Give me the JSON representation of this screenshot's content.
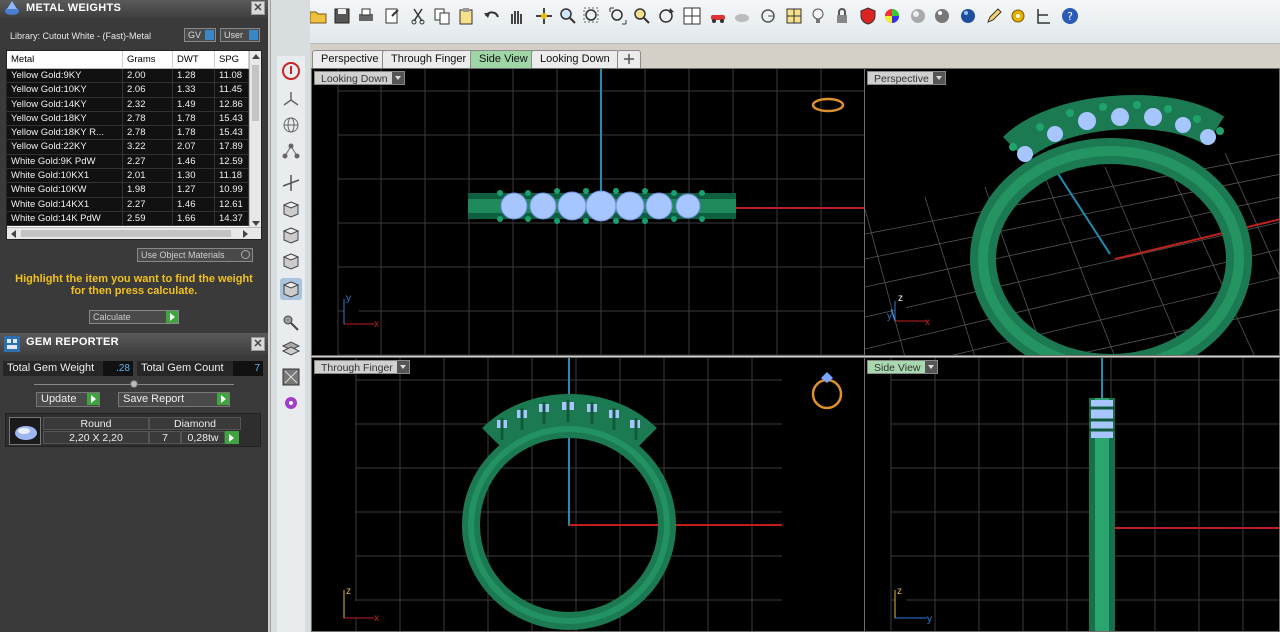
{
  "metal_weights": {
    "title": "METAL WEIGHTS",
    "library": "Library: Cutout White - (Fast)-Metal",
    "gv_label": "GV",
    "user_label": "User",
    "columns": [
      "Metal",
      "Grams",
      "DWT",
      "SPG"
    ],
    "rows": [
      [
        "Yellow Gold:9KY",
        "2.00",
        "1.28",
        "11.08"
      ],
      [
        "Yellow Gold:10KY",
        "2.06",
        "1.33",
        "11.45"
      ],
      [
        "Yellow Gold:14KY",
        "2.32",
        "1.49",
        "12.86"
      ],
      [
        "Yellow Gold:18KY",
        "2.78",
        "1.78",
        "15.43"
      ],
      [
        "Yellow Gold:18KY R...",
        "2.78",
        "1.78",
        "15.43"
      ],
      [
        "Yellow Gold:22KY",
        "3.22",
        "2.07",
        "17.89"
      ],
      [
        "White Gold:9K PdW",
        "2.27",
        "1.46",
        "12.59"
      ],
      [
        "White Gold:10KX1",
        "2.01",
        "1.30",
        "11.18"
      ],
      [
        "White Gold:10KW",
        "1.98",
        "1.27",
        "10.99"
      ],
      [
        "White Gold:14KX1",
        "2.27",
        "1.46",
        "12.61"
      ],
      [
        "White Gold:14K PdW",
        "2.59",
        "1.66",
        "14.37"
      ]
    ],
    "use_object_materials": "Use Object Materials",
    "hint": "Highlight the item you want to find the weight for then press calculate.",
    "calculate_label": "Calculate"
  },
  "gem_reporter": {
    "title": "GEM REPORTER",
    "total_weight_label": "Total Gem Weight",
    "total_weight_value": ".28",
    "total_count_label": "Total Gem Count",
    "total_count_value": "7",
    "update_label": "Update",
    "save_report_label": "Save Report",
    "gem": {
      "shape": "Round",
      "type": "Diamond",
      "size": "2,20 X 2,20",
      "count": "7",
      "weight": "0,28tw"
    }
  },
  "tabs": [
    "Perspective",
    "Through Finger",
    "Side View",
    "Looking Down"
  ],
  "active_tab": "Side View",
  "viewports": {
    "top_left": "Looking Down",
    "top_right": "Perspective",
    "bottom_left": "Through Finger",
    "bottom_right": "Side View"
  },
  "axes": {
    "top_left": [
      "y",
      "x"
    ],
    "top_right": [
      "z",
      "y",
      "x"
    ],
    "bottom_left": [
      "z",
      "x"
    ],
    "bottom_right": [
      "z",
      "y"
    ]
  },
  "colors": {
    "panel_bg": "#3a3a3a",
    "hint_text": "#f2c21b",
    "ring_green": "#1e8a5a",
    "gem_blue": "#a7c6ff",
    "accent_green": "#3ea53e",
    "value_blue": "#5db4e8"
  }
}
